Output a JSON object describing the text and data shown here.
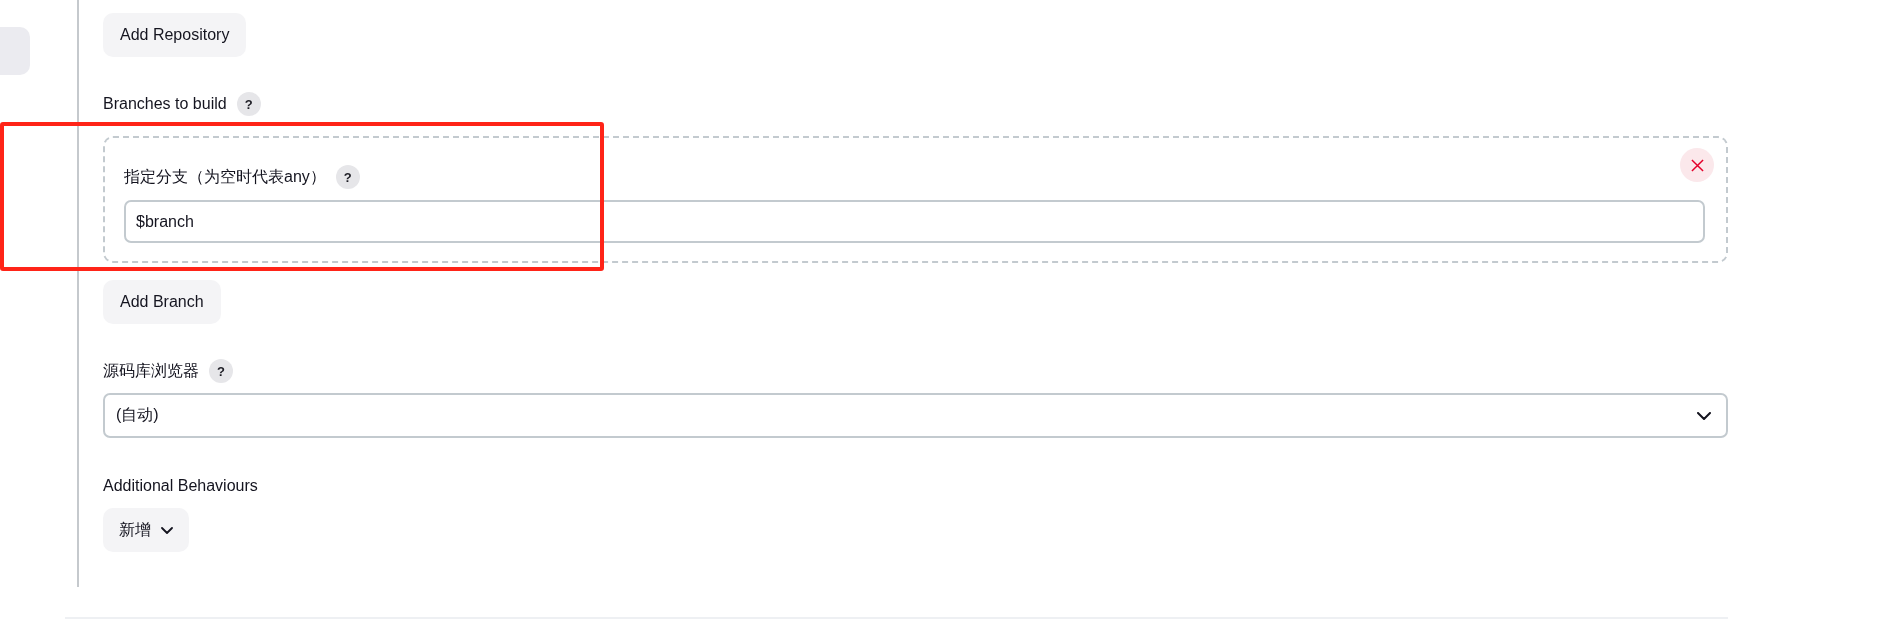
{
  "repositories": {
    "add_button": "Add Repository"
  },
  "branches": {
    "label": "Branches to build",
    "help": "?",
    "items": [
      {
        "label": "指定分支（为空时代表any）",
        "help": "?",
        "value": "$branch"
      }
    ],
    "add_button": "Add Branch"
  },
  "repository_browser": {
    "label": "源码库浏览器",
    "help": "?",
    "value": "(自动)"
  },
  "additional_behaviours": {
    "label": "Additional Behaviours",
    "add_button": "新增"
  }
}
